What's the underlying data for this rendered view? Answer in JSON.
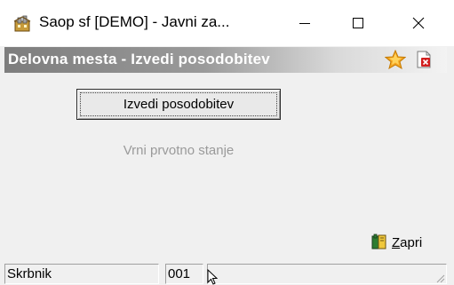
{
  "window": {
    "title": "Saop sf [DEMO] - Javni za..."
  },
  "header": {
    "title": "Delovna mesta - Izvedi posodobitev"
  },
  "actions": {
    "update_label": "Izvedi posodobitev",
    "reset_label": "Vrni prvotno stanje",
    "close_label_accel": "Z",
    "close_label_rest": "apri"
  },
  "statusbar": {
    "user": "Skrbnik",
    "code": "001",
    "message": ""
  },
  "icons": {
    "app": "app-building-icon",
    "favorite": "star-icon",
    "close_doc": "close-document-icon",
    "close_action": "book-icon"
  },
  "colors": {
    "header_gradient_start": "#7d7d7d",
    "header_gradient_end": "#f3f3f3",
    "star": "#f5a623",
    "close_doc_red": "#d21f1f",
    "disabled_text": "#9a9a9a"
  }
}
